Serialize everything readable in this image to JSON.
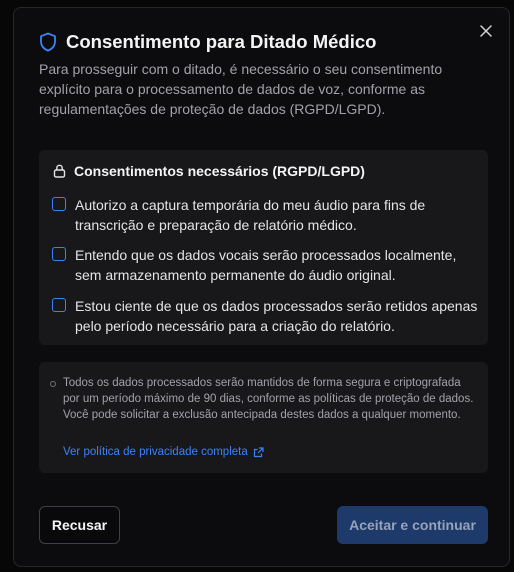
{
  "dialog": {
    "title": "Consentimento para Ditado Médico",
    "description": "Para prosseguir com o ditado, é necessário o seu consentimento explícito para o processamento de dados de voz, conforme as regulamentações de proteção de dados (RGPD/LGPD).",
    "title_icon": "shield-icon",
    "close_icon": "close-icon"
  },
  "consents": {
    "heading": "Consentimentos necessários (RGPD/LGPD)",
    "heading_icon": "lock-icon",
    "items": [
      {
        "label": "Autorizo a captura temporária do meu áudio para fins de transcrição e preparação de relatório médico.",
        "checked": false
      },
      {
        "label": "Entendo que os dados vocais serão processados localmente, sem armazenamento permanente do áudio original.",
        "checked": false
      },
      {
        "label": "Estou ciente de que os dados processados serão retidos apenas pelo período necessário para a criação do relatório.",
        "checked": false
      }
    ]
  },
  "info": {
    "text": "Todos os dados processados serão mantidos de forma segura e criptografada por um período máximo de 90 dias, conforme as políticas de proteção de dados. Você pode solicitar a exclusão antecipada destes dados a qualquer momento.",
    "link_label": "Ver política de privacidade completa",
    "link_icon": "external-link-icon"
  },
  "actions": {
    "cancel_label": "Recusar",
    "accept_label": "Aceitar e continuar",
    "accept_enabled": false
  },
  "colors": {
    "accent": "#3b82f6",
    "accept_disabled_bg": "#1e3a6b",
    "panel_bg": "#18181b",
    "modal_bg": "#0c0c0e"
  }
}
